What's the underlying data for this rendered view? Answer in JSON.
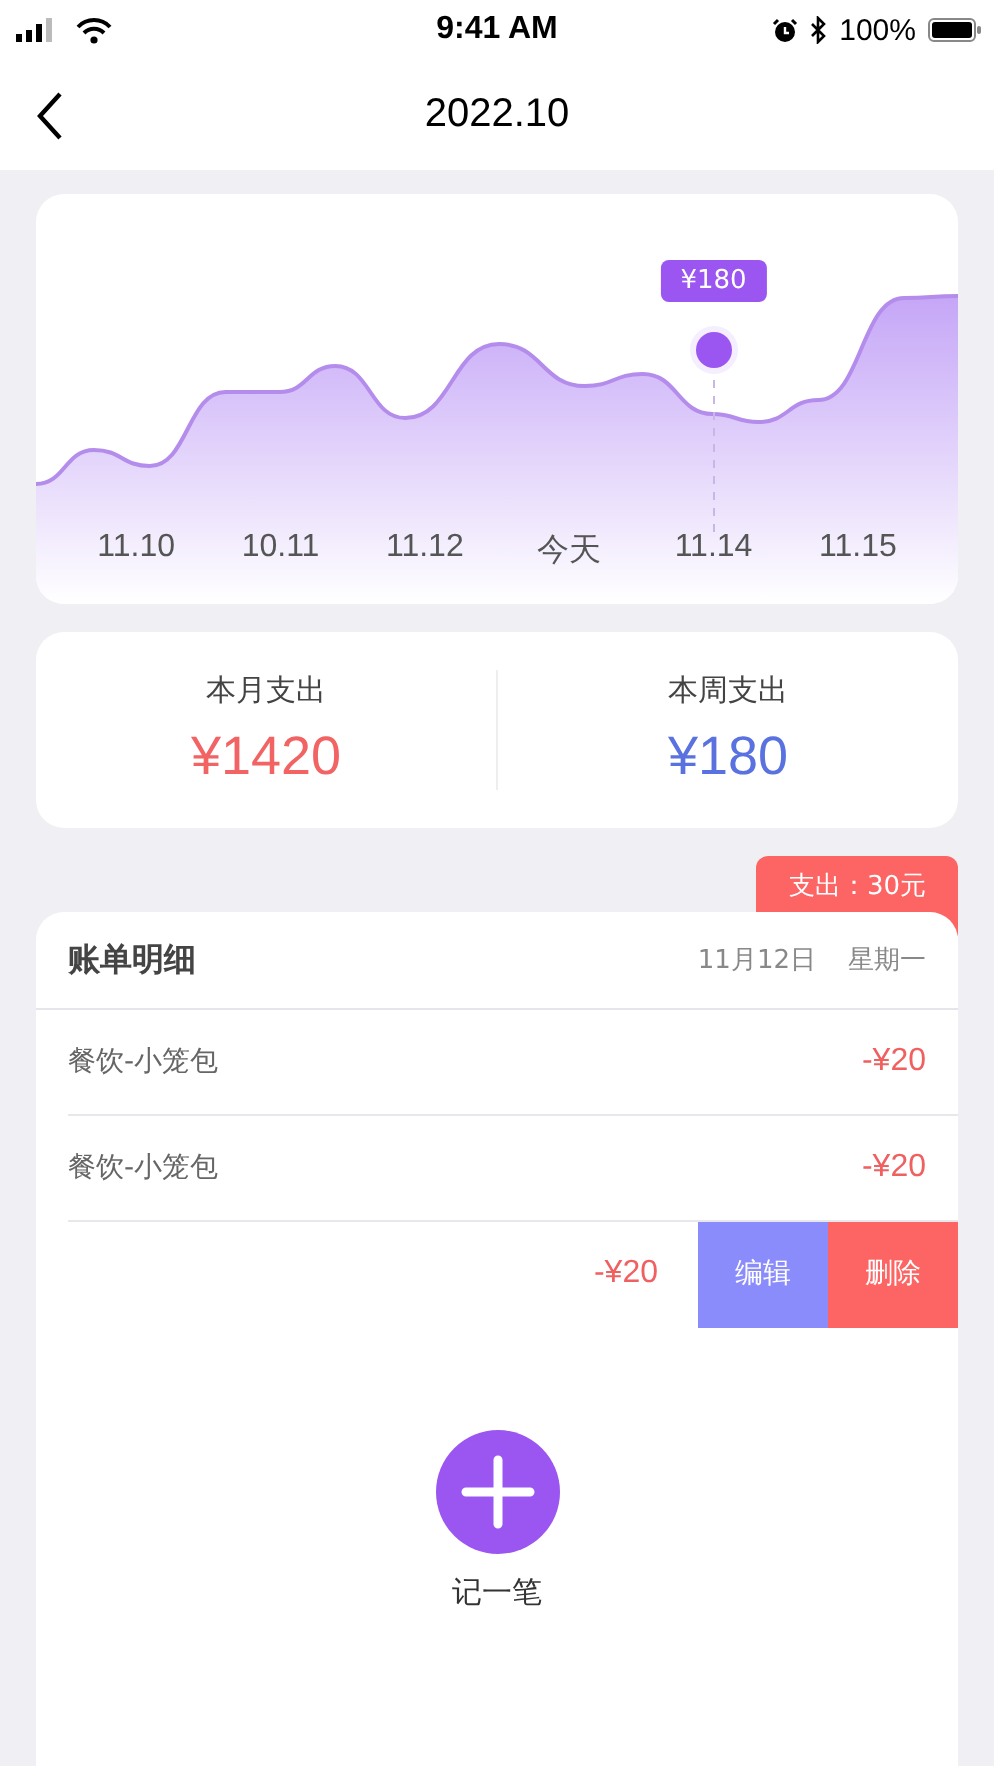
{
  "status_bar": {
    "time": "9:41 AM",
    "battery": "100%"
  },
  "nav": {
    "title": "2022.10"
  },
  "chart": {
    "tooltip": "¥180",
    "labels": [
      {
        "text": "11.10",
        "selected": false
      },
      {
        "text": "10.11",
        "selected": false
      },
      {
        "text": "11.12",
        "selected": false
      },
      {
        "text": "今天",
        "selected": false
      },
      {
        "text": "11.14",
        "selected": true
      },
      {
        "text": "11.15",
        "selected": false
      }
    ]
  },
  "stats": [
    {
      "label": "本月支出",
      "value": "¥1420",
      "color": "#f26363"
    },
    {
      "label": "本周支出",
      "value": "¥180",
      "color": "#5a72e0"
    }
  ],
  "bill": {
    "tag": "支出：30元",
    "title": "账单明细",
    "date": "11月12日",
    "weekday": "星期一",
    "rows": [
      {
        "kind": "normal",
        "name": "餐饮-小笼包",
        "amount": "-¥20"
      },
      {
        "kind": "normal",
        "name": "餐饮-小笼包",
        "amount": "-¥20"
      },
      {
        "kind": "swiped",
        "amount": "-¥20",
        "actions": [
          {
            "label": "编辑",
            "color": "#8a8cfc"
          },
          {
            "label": "删除",
            "color": "#fd6464"
          }
        ]
      }
    ]
  },
  "add": {
    "label": "记一笔"
  }
}
